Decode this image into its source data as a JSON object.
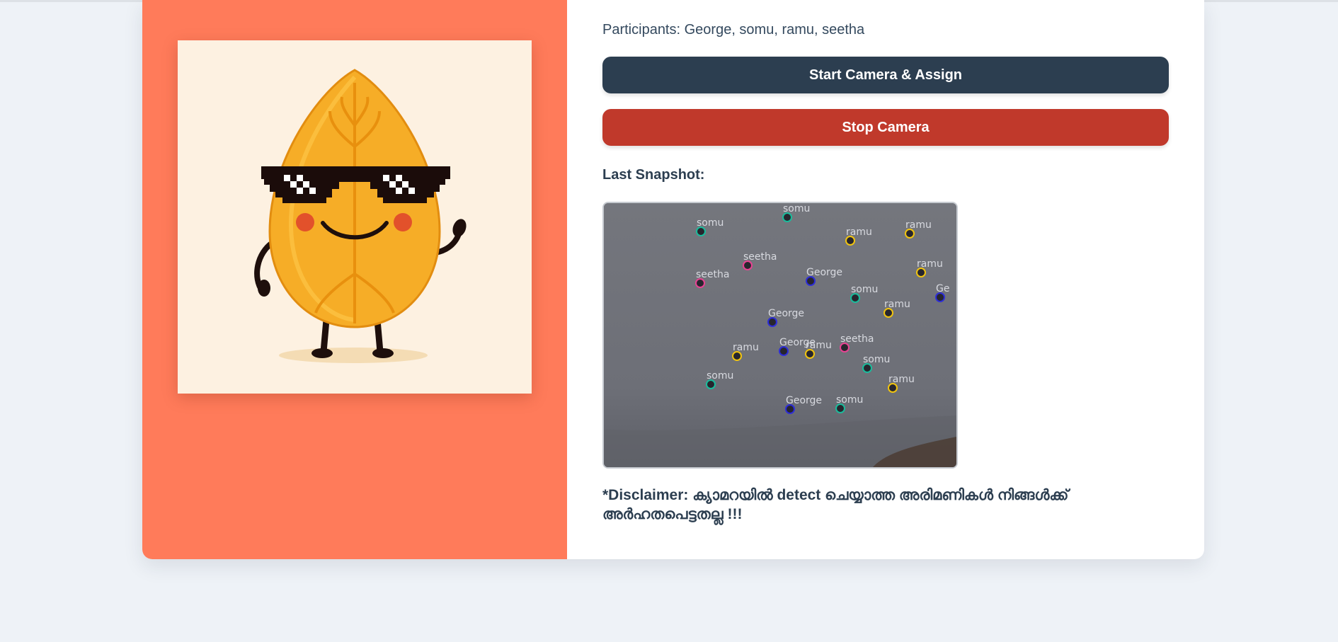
{
  "participants_text": "Participants: George, somu, ramu, seetha",
  "buttons": {
    "start": "Start Camera & Assign",
    "stop": "Stop Camera"
  },
  "snapshot": {
    "label": "Last Snapshot:",
    "tags": [
      {
        "name": "somu",
        "color": "#1abc9c"
      },
      {
        "name": "somu",
        "color": "#1abc9c"
      },
      {
        "name": "ramu",
        "color": "#f1c40f"
      },
      {
        "name": "ramu",
        "color": "#f1c40f"
      },
      {
        "name": "seetha",
        "color": "#e84393"
      },
      {
        "name": "seetha",
        "color": "#e84393"
      },
      {
        "name": "George",
        "color": "#2d2dd8"
      },
      {
        "name": "ramu",
        "color": "#f1c40f"
      },
      {
        "name": "Ge",
        "color": "#2d2dd8"
      },
      {
        "name": "somu",
        "color": "#1abc9c"
      },
      {
        "name": "ramu",
        "color": "#f1c40f"
      },
      {
        "name": "George",
        "color": "#2d2dd8"
      },
      {
        "name": "seetha",
        "color": "#e84393"
      },
      {
        "name": "George",
        "color": "#2d2dd8"
      },
      {
        "name": "ramu",
        "color": "#f1c40f"
      },
      {
        "name": "ramu",
        "color": "#f1c40f"
      },
      {
        "name": "somu",
        "color": "#1abc9c"
      },
      {
        "name": "somu",
        "color": "#1abc9c"
      },
      {
        "name": "ramu",
        "color": "#f1c40f"
      },
      {
        "name": "George",
        "color": "#2d2dd8"
      },
      {
        "name": "somu",
        "color": "#1abc9c"
      }
    ]
  },
  "disclaimer": "*Disclaimer: ക്യാമറയിൽ detect ചെയ്യാത്ത അരിമണികൾ നിങ്ങൾക്ക് അർഹതപെട്ടതല്ല !!!",
  "colors": {
    "left_panel": "#ff7b5a",
    "start_button": "#2c3e50",
    "stop_button": "#c0392b"
  }
}
